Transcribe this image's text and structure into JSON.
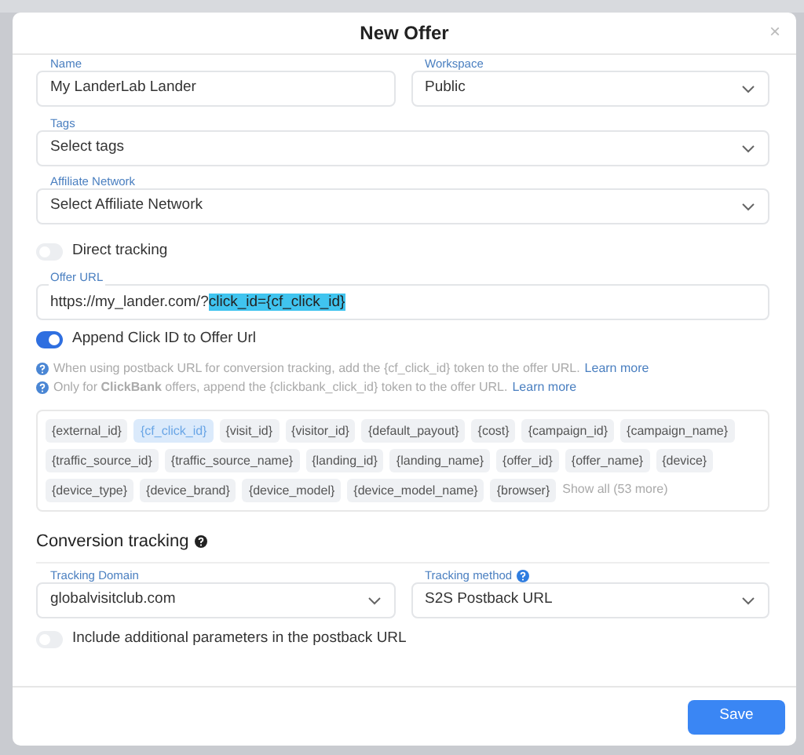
{
  "modal": {
    "title": "New Offer",
    "close": "×"
  },
  "fields_row1": [
    {
      "label": "Name",
      "kind": "input",
      "value": "My LanderLab Lander"
    },
    {
      "label": "Workspace",
      "kind": "select",
      "value": "Public"
    }
  ],
  "tags": {
    "label": "Tags",
    "kind": "select",
    "value": "Select tags"
  },
  "affiliate_network": {
    "label": "Affiliate Network",
    "kind": "select",
    "value": "Select Affiliate Network"
  },
  "direct_tracking": {
    "label": "Direct tracking",
    "on": false
  },
  "offer_url": {
    "label": "Offer URL",
    "value": "https://my_lander.com/?",
    "highlighted": "click_id={cf_click_id}"
  },
  "append_click_id": {
    "label": "Append Click ID to Offer Url",
    "on": true
  },
  "help": [
    {
      "text": "When using postback URL for conversion tracking, add the {cf_click_id} token to the offer URL.",
      "link": "Learn more"
    },
    {
      "text": "Only for **ClickBank** offers, append the {clickbank_click_id} token to the offer URL.",
      "link": "Learn more"
    }
  ],
  "tokens": [
    {
      "label": "{external_id}",
      "selected": false
    },
    {
      "label": "{cf_click_id}",
      "selected": true
    },
    {
      "label": "{visit_id}",
      "selected": false
    },
    {
      "label": "{visitor_id}",
      "selected": false
    },
    {
      "label": "{default_payout}",
      "selected": false
    },
    {
      "label": "{cost}",
      "selected": false
    },
    {
      "label": "{campaign_id}",
      "selected": false
    },
    {
      "label": "{campaign_name}",
      "selected": false
    },
    {
      "label": "{traffic_source_id}",
      "selected": false
    },
    {
      "label": "{traffic_source_name}",
      "selected": false
    },
    {
      "label": "{landing_id}",
      "selected": false
    },
    {
      "label": "{landing_name}",
      "selected": false
    },
    {
      "label": "{offer_id}",
      "selected": false
    },
    {
      "label": "{offer_name}",
      "selected": false
    },
    {
      "label": "{device}",
      "selected": false
    },
    {
      "label": "{device_type}",
      "selected": false
    },
    {
      "label": "{device_brand}",
      "selected": false
    },
    {
      "label": "{device_model}",
      "selected": false
    },
    {
      "label": "{device_model_name}",
      "selected": false
    },
    {
      "label": "{browser}",
      "selected": false
    }
  ],
  "show_all": "Show all (53 more)",
  "conversion_tracking": {
    "heading": "Conversion tracking",
    "fields": [
      {
        "label": "Tracking Domain",
        "kind": "select",
        "value": "globalvisitclub.com",
        "help": false
      },
      {
        "label": "Tracking method",
        "kind": "select",
        "value": "S2S Postback URL",
        "help": true
      }
    ],
    "include_params": {
      "label": "Include additional parameters in the postback URL",
      "on": false
    }
  },
  "save": "Save"
}
